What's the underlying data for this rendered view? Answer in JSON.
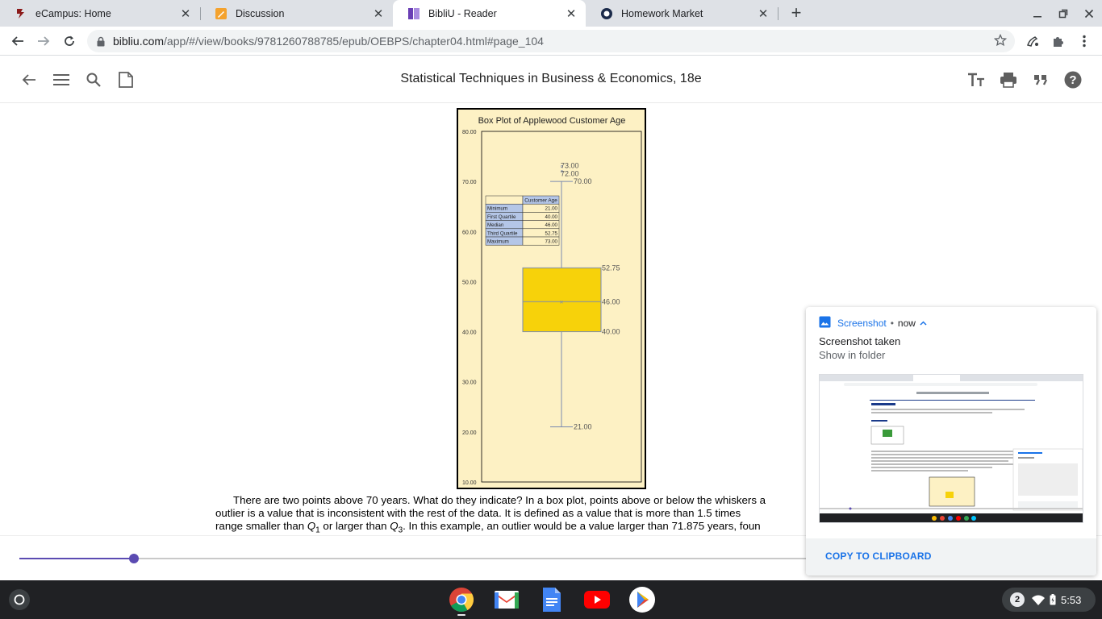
{
  "tabs": [
    {
      "title": "eCampus: Home",
      "icon": "ecampus-icon",
      "active": false
    },
    {
      "title": "Discussion",
      "icon": "pencil-icon",
      "active": false
    },
    {
      "title": "BibliU - Reader",
      "icon": "bibliu-icon",
      "active": true
    },
    {
      "title": "Homework Market",
      "icon": "homework-market-icon",
      "active": false
    }
  ],
  "toolbar": {
    "url_host": "bibliu.com",
    "url_path": "/app/#/view/books/9781260788785/epub/OEBPS/chapter04.html#page_104"
  },
  "reader": {
    "book_title": "Statistical Techniques in Business & Economics, 18e",
    "progress_fraction": 0.145
  },
  "chart_data": {
    "type": "box",
    "title": "Box Plot of Applewood Customer Age",
    "ylim": [
      10,
      80
    ],
    "y_ticks": [
      "80.00",
      "70.00",
      "60.00",
      "50.00",
      "40.00",
      "30.00",
      "20.00",
      "10.00"
    ],
    "summary": {
      "minimum": 21.0,
      "first_quartile": 40.0,
      "median": 46.0,
      "third_quartile": 52.75,
      "upper_whisker": 70.0,
      "outliers": [
        72.0,
        73.0
      ]
    },
    "value_labels": {
      "upper_whisker": "70.00",
      "q3": "52.75",
      "median": "46.00",
      "q1": "40.00",
      "minimum": "21.00",
      "outlier_1": "72.00",
      "outlier_2": "73.00"
    },
    "table": {
      "header": "Customer Age",
      "rows": [
        {
          "label": "Minimum",
          "value": "21.00"
        },
        {
          "label": "First Quartile",
          "value": "40.00"
        },
        {
          "label": "Median",
          "value": "46.00"
        },
        {
          "label": "Third Quartile",
          "value": "52.75"
        },
        {
          "label": "Maximum",
          "value": "73.00"
        }
      ]
    },
    "colors": {
      "background": "#fdf1c4",
      "box": "#f7d20a",
      "table_label": "#b4c6e7"
    }
  },
  "body_text": {
    "line1": "There are two points above 70 years. What do they indicate? In a box plot, points above or below the whiskers a",
    "line2": "outlier is a value that is inconsistent with the rest of the data. It is defined as a value that is more than 1.5 times",
    "line3_a": "range smaller than ",
    "line3_q": "Q",
    "line3_sub1": "1",
    "line3_b": " or larger than ",
    "line3_sub3": "3",
    "line3_c": ". In this example, an outlier would be a value larger than 71.875 years, foun"
  },
  "notification": {
    "app": "Screenshot",
    "separator": "•",
    "when": "now",
    "title": "Screenshot taken",
    "subtitle": "Show in folder",
    "action": "COPY TO CLIPBOARD"
  },
  "shelf": {
    "apps": [
      "chrome-icon",
      "gmail-icon",
      "docs-icon",
      "youtube-icon",
      "play-store-icon"
    ],
    "notification_count": "2",
    "time": "5:53"
  }
}
